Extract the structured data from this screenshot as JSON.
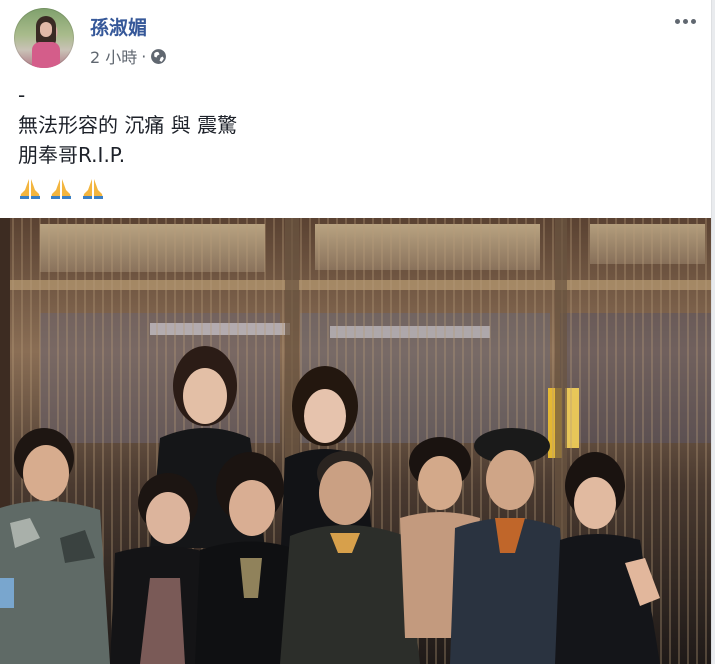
{
  "post": {
    "author": "孫淑媚",
    "time": "2 小時",
    "separator": "·",
    "lines": [
      "-",
      "無法形容的 沉痛 與 震驚",
      "朋奉哥R.I.P."
    ],
    "emoji": "folded-hands-icon x3"
  },
  "colors": {
    "author_link": "#365899",
    "meta_text": "#606770",
    "body_text": "#1d2129"
  }
}
